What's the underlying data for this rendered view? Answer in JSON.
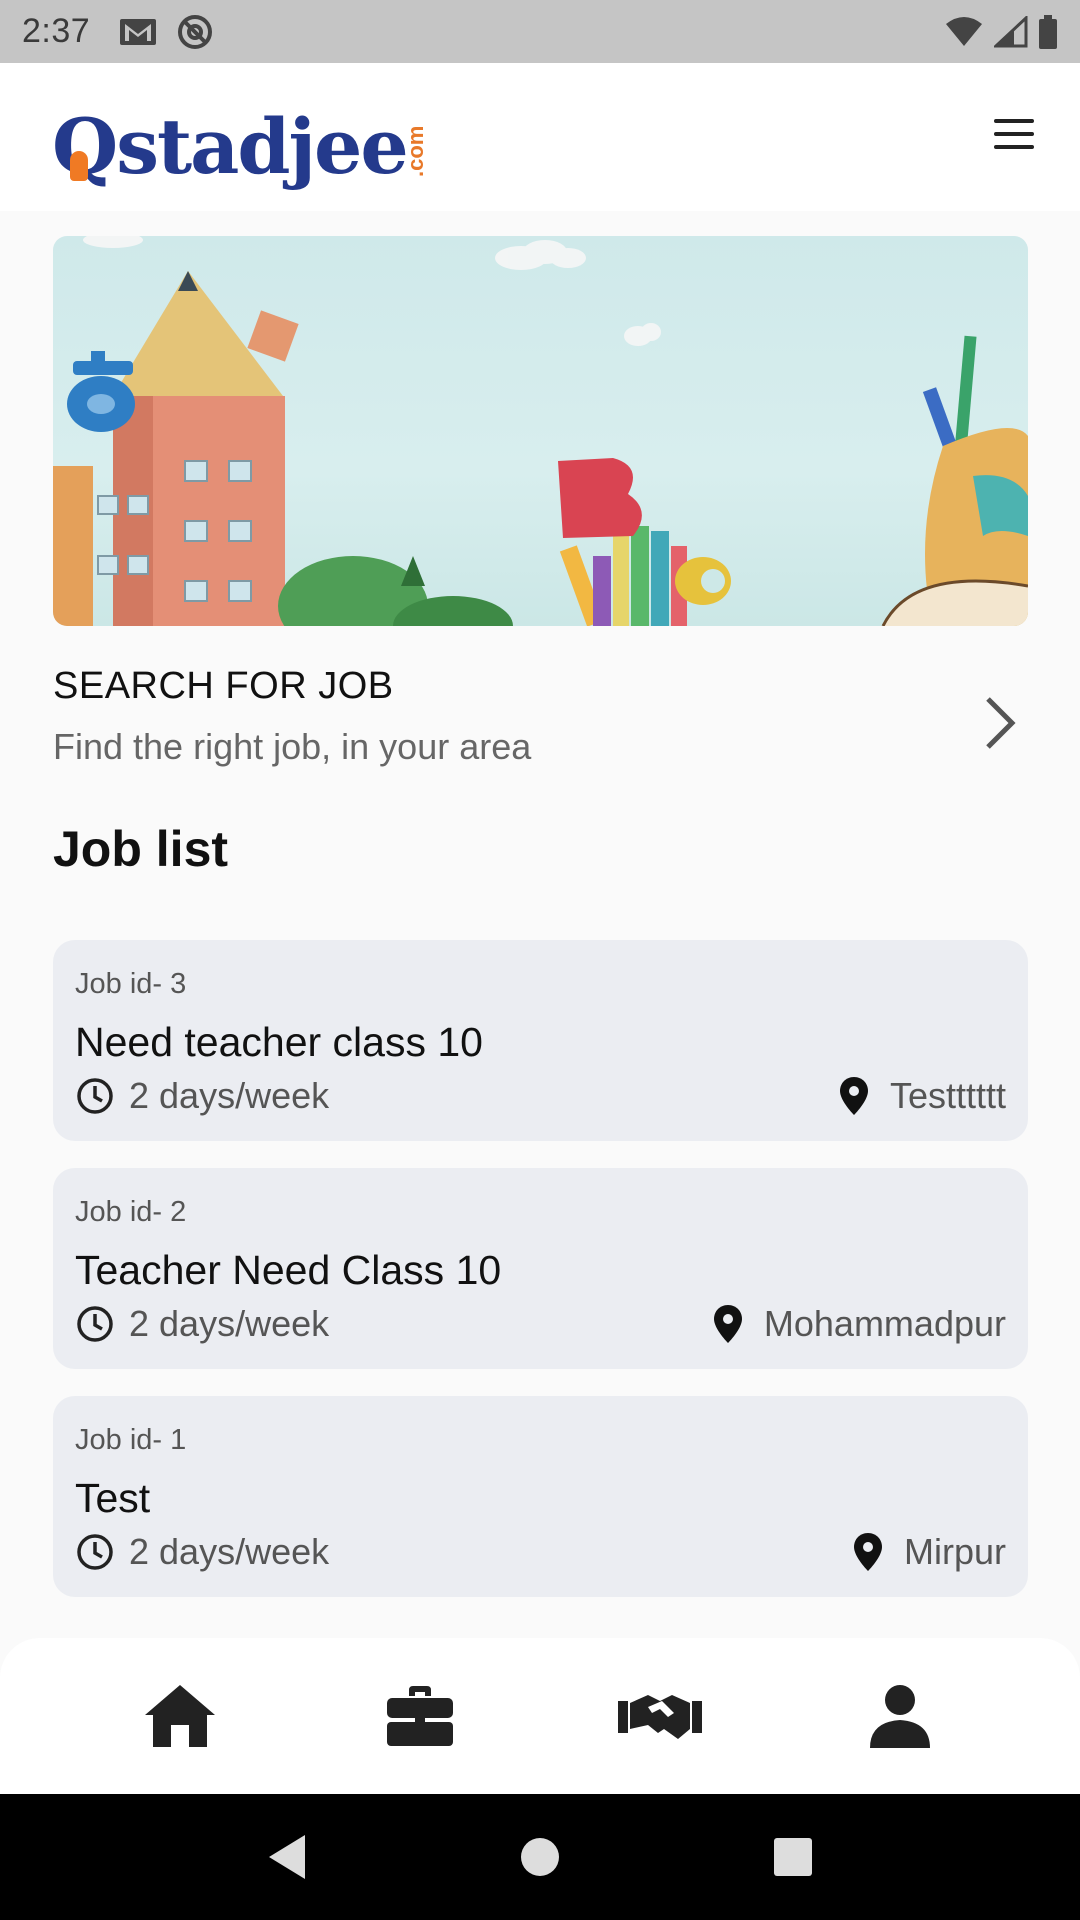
{
  "status_bar": {
    "time": "2:37"
  },
  "header": {
    "logo_text": "Qstadjee",
    "logo_suffix": ".com"
  },
  "search_job": {
    "title": "SEARCH FOR JOB",
    "subtitle": "Find the right job, in your area"
  },
  "job_list": {
    "title": "Job list",
    "items": [
      {
        "job_id": "Job id- 3",
        "title": "Need teacher class 10",
        "schedule": "2 days/week",
        "location": "Testttttt"
      },
      {
        "job_id": "Job id- 2",
        "title": "Teacher Need Class 10",
        "schedule": "2 days/week",
        "location": "Mohammadpur"
      },
      {
        "job_id": "Job id- 1",
        "title": "Test",
        "schedule": "2 days/week",
        "location": "Mirpur"
      }
    ]
  },
  "bottom_nav": {
    "items": [
      {
        "icon": "home-icon"
      },
      {
        "icon": "briefcase-icon"
      },
      {
        "icon": "handshake-icon"
      },
      {
        "icon": "person-icon"
      }
    ]
  },
  "colors": {
    "brand_blue": "#243a8c",
    "brand_orange": "#f07a24",
    "card_bg": "#ebedf2"
  }
}
